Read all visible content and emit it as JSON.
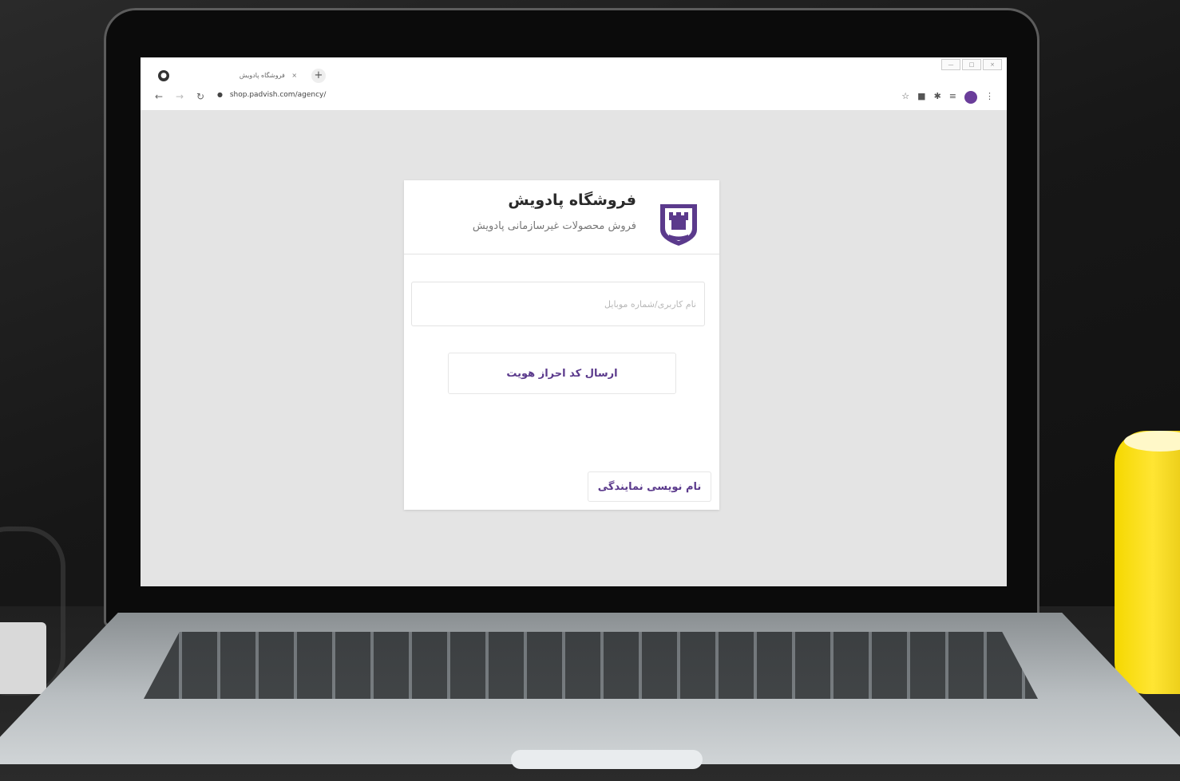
{
  "browser": {
    "tab_title": "فروشگاه پادویش",
    "tab_close": "×",
    "new_tab": "+",
    "address": "shop.padvish.com/agency/",
    "lock_icon": "lock-icon"
  },
  "card": {
    "title": "فروشگاه پادویش",
    "subtitle": "فروش محصولات غیرسازمانی پادویش",
    "input_placeholder": "نام کاربری/شماره موبایل",
    "input_value": "",
    "send_button": "ارسال کد احراز هویت",
    "register_button": "نام نویسی نمایندگی"
  },
  "colors": {
    "brand": "#5b3a8c",
    "page_bg": "#e4e4e4",
    "accent_yellow": "#f5d800"
  }
}
